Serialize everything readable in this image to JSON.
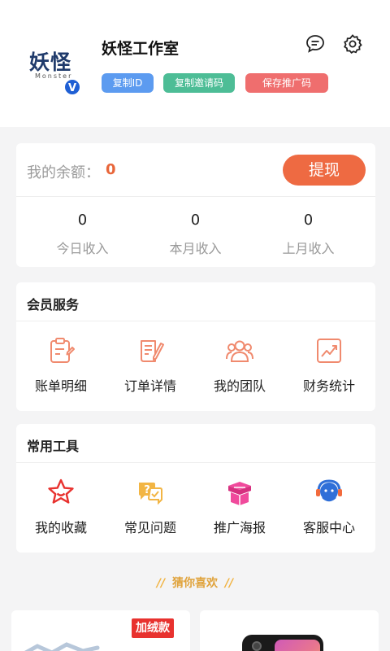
{
  "profile": {
    "logo_text": "妖怪",
    "logo_subtext": "Monster",
    "verified_badge": "V",
    "name": "妖怪工作室",
    "actions": {
      "copy_id": "复制ID",
      "copy_invite": "复制邀请码",
      "save_promo": "保存推广码"
    },
    "icons": [
      "message-icon",
      "settings-icon"
    ]
  },
  "balance": {
    "label": "我的余额：",
    "value": "0",
    "withdraw_label": "提现",
    "stats": [
      {
        "value": "0",
        "label": "今日收入"
      },
      {
        "value": "0",
        "label": "本月收入"
      },
      {
        "value": "0",
        "label": "上月收入"
      }
    ]
  },
  "member_services": {
    "title": "会员服务",
    "items": [
      {
        "label": "账单明细",
        "icon": "bill-icon"
      },
      {
        "label": "订单详情",
        "icon": "order-icon"
      },
      {
        "label": "我的团队",
        "icon": "team-icon"
      },
      {
        "label": "财务统计",
        "icon": "chart-icon"
      }
    ]
  },
  "common_tools": {
    "title": "常用工具",
    "items": [
      {
        "label": "我的收藏",
        "icon": "star-icon"
      },
      {
        "label": "常见问题",
        "icon": "faq-icon"
      },
      {
        "label": "推广海报",
        "icon": "gift-box-icon"
      },
      {
        "label": "客服中心",
        "icon": "headset-icon"
      }
    ]
  },
  "recommend": {
    "title": "猜你喜欢",
    "products": [
      {
        "tag": "加绒款"
      }
    ]
  },
  "colors": {
    "accent": "#ee6a42",
    "blue_pill": "#5c9bf0",
    "green_pill": "#4dbd96",
    "red_pill": "#ef6e6e",
    "icon_orange": "#f08a6e",
    "guess_gold": "#e0a33c"
  }
}
